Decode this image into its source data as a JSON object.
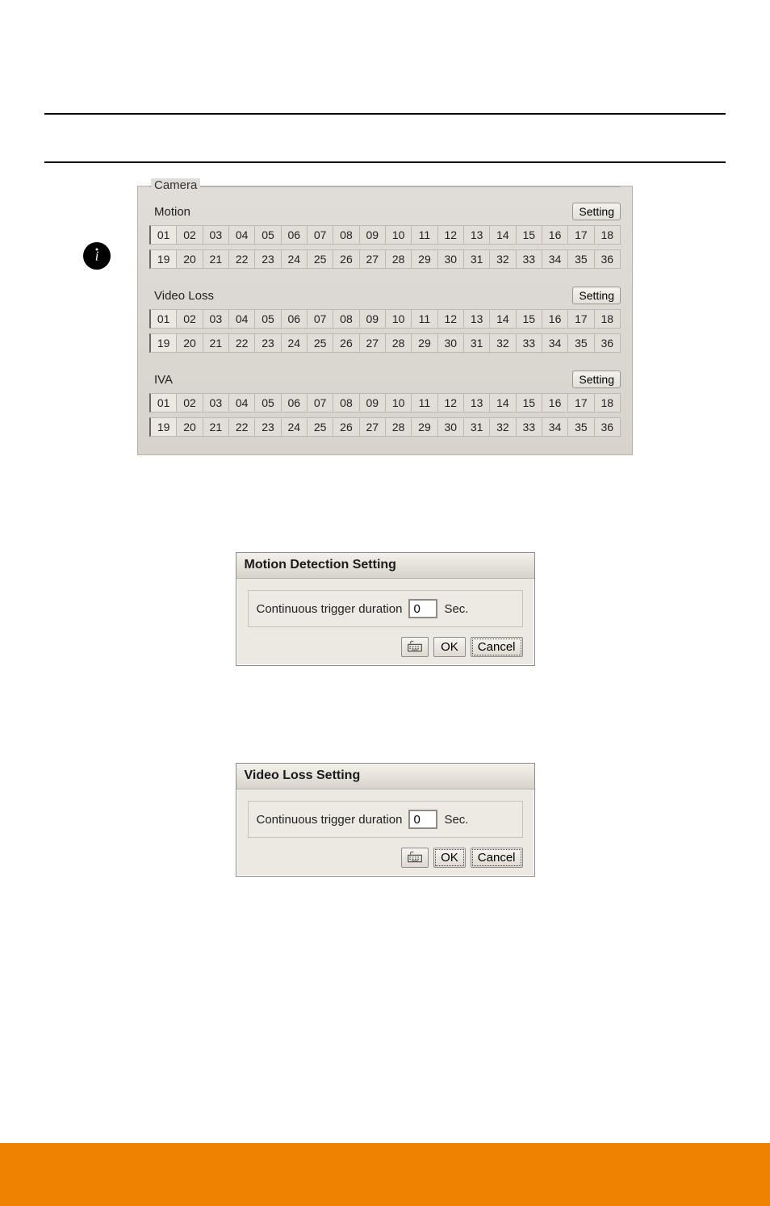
{
  "camera_panel": {
    "legend": "Camera",
    "sections": [
      {
        "label": "Motion",
        "button": "Setting",
        "rows": [
          [
            "01",
            "02",
            "03",
            "04",
            "05",
            "06",
            "07",
            "08",
            "09",
            "10",
            "11",
            "12",
            "13",
            "14",
            "15",
            "16",
            "17",
            "18"
          ],
          [
            "19",
            "20",
            "21",
            "22",
            "23",
            "24",
            "25",
            "26",
            "27",
            "28",
            "29",
            "30",
            "31",
            "32",
            "33",
            "34",
            "35",
            "36"
          ]
        ]
      },
      {
        "label": "Video Loss",
        "button": "Setting",
        "rows": [
          [
            "01",
            "02",
            "03",
            "04",
            "05",
            "06",
            "07",
            "08",
            "09",
            "10",
            "11",
            "12",
            "13",
            "14",
            "15",
            "16",
            "17",
            "18"
          ],
          [
            "19",
            "20",
            "21",
            "22",
            "23",
            "24",
            "25",
            "26",
            "27",
            "28",
            "29",
            "30",
            "31",
            "32",
            "33",
            "34",
            "35",
            "36"
          ]
        ]
      },
      {
        "label": "IVA",
        "button": "Setting",
        "rows": [
          [
            "01",
            "02",
            "03",
            "04",
            "05",
            "06",
            "07",
            "08",
            "09",
            "10",
            "11",
            "12",
            "13",
            "14",
            "15",
            "16",
            "17",
            "18"
          ],
          [
            "19",
            "20",
            "21",
            "22",
            "23",
            "24",
            "25",
            "26",
            "27",
            "28",
            "29",
            "30",
            "31",
            "32",
            "33",
            "34",
            "35",
            "36"
          ]
        ]
      }
    ]
  },
  "dialogs": [
    {
      "title": "Motion Detection Setting",
      "field_label": "Continuous trigger duration",
      "value": "0",
      "unit": "Sec.",
      "ok": "OK",
      "cancel": "Cancel",
      "default": "cancel"
    },
    {
      "title": "Video Loss Setting",
      "field_label": "Continuous trigger duration",
      "value": "0",
      "unit": "Sec.",
      "ok": "OK",
      "cancel": "Cancel",
      "default": "ok"
    }
  ]
}
